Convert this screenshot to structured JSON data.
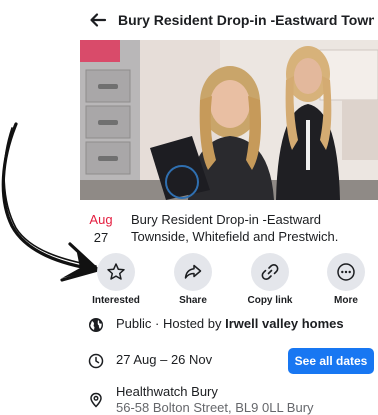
{
  "header": {
    "title": "Bury Resident Drop-in -Eastward Town..."
  },
  "event": {
    "month": "Aug",
    "day": "27",
    "title": "Bury Resident Drop-in -Eastward Townside, Whitefield and Prestwich."
  },
  "actions": [
    {
      "label": "Interested",
      "icon": "star-icon"
    },
    {
      "label": "Share",
      "icon": "share-icon"
    },
    {
      "label": "Copy link",
      "icon": "link-icon"
    },
    {
      "label": "More",
      "icon": "more-icon"
    }
  ],
  "info": {
    "privacy_prefix": "Public · Hosted by ",
    "host": "Irwell valley homes",
    "dates": "27 Aug – 26 Nov",
    "see_all_label": "See all dates",
    "location_name": "Healthwatch Bury",
    "location_address": "56-58 Bolton Street, BL9 0LL Bury"
  },
  "colors": {
    "accent": "#1877f2",
    "month_red": "#e41e3f",
    "action_bg": "#e4e6eb"
  }
}
